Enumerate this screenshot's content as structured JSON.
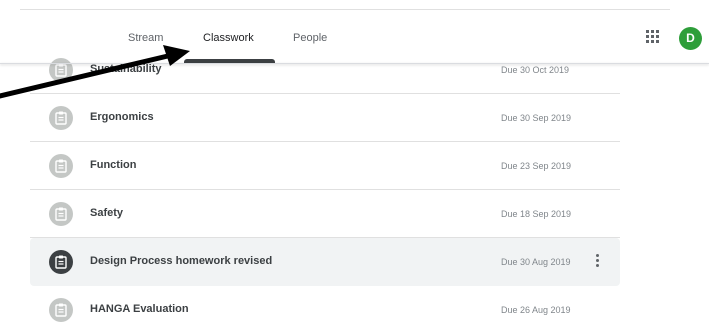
{
  "tabs": [
    {
      "label": "Stream"
    },
    {
      "label": "Classwork"
    },
    {
      "label": "People"
    }
  ],
  "avatar": {
    "initial": "D",
    "color": "#2e9e3a"
  },
  "assignments": [
    {
      "title": "Sustainability",
      "due": "Due 30 Oct 2019"
    },
    {
      "title": "Ergonomics",
      "due": "Due 30 Sep 2019"
    },
    {
      "title": "Function",
      "due": "Due 23 Sep 2019"
    },
    {
      "title": "Safety",
      "due": "Due 18 Sep 2019"
    },
    {
      "title": "Design Process homework revised",
      "due": "Due 30 Aug 2019"
    },
    {
      "title": "HANGA Evaluation",
      "due": "Due 26 Aug 2019"
    }
  ],
  "icons": {
    "assignment": "assignment-icon",
    "apps": "apps-grid-icon",
    "more": "more-vert-icon"
  }
}
